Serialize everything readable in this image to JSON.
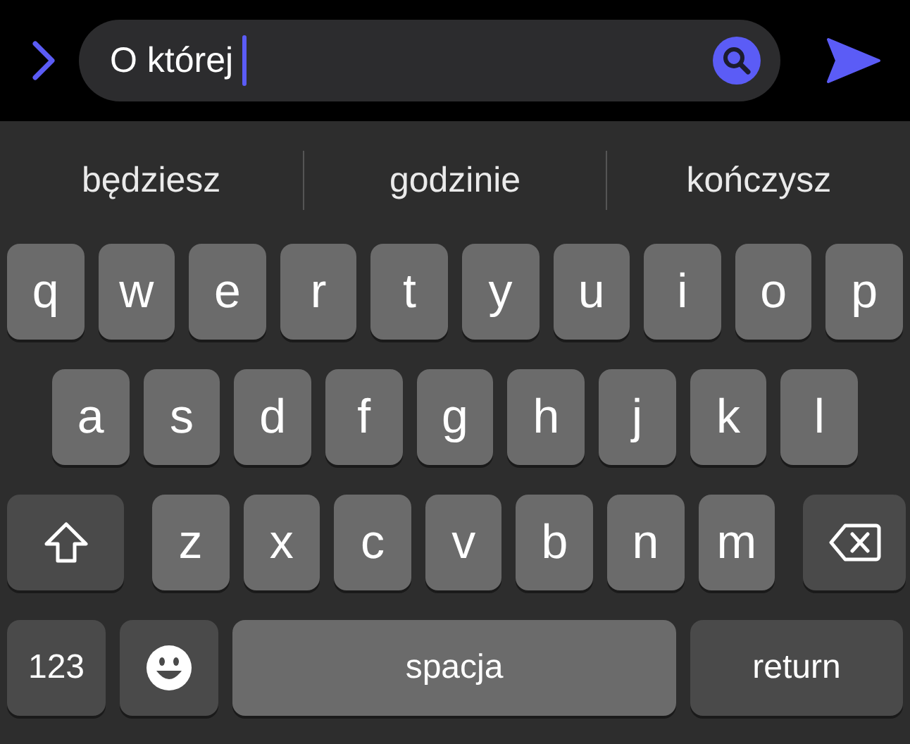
{
  "search_bar": {
    "value": "O której"
  },
  "suggestions": [
    "będziesz",
    "godzinie",
    "kończysz"
  ],
  "keyboard": {
    "rows": [
      {
        "keys": [
          {
            "kind": "letter",
            "label": "q"
          },
          {
            "kind": "letter",
            "label": "w"
          },
          {
            "kind": "letter",
            "label": "e"
          },
          {
            "kind": "letter",
            "label": "r"
          },
          {
            "kind": "letter",
            "label": "t"
          },
          {
            "kind": "letter",
            "label": "y"
          },
          {
            "kind": "letter",
            "label": "u"
          },
          {
            "kind": "letter",
            "label": "i"
          },
          {
            "kind": "letter",
            "label": "o"
          },
          {
            "kind": "letter",
            "label": "p"
          }
        ]
      },
      {
        "keys": [
          {
            "kind": "letter",
            "label": "a"
          },
          {
            "kind": "letter",
            "label": "s"
          },
          {
            "kind": "letter",
            "label": "d"
          },
          {
            "kind": "letter",
            "label": "f"
          },
          {
            "kind": "letter",
            "label": "g"
          },
          {
            "kind": "letter",
            "label": "h"
          },
          {
            "kind": "letter",
            "label": "j"
          },
          {
            "kind": "letter",
            "label": "k"
          },
          {
            "kind": "letter",
            "label": "l"
          }
        ]
      },
      {
        "keys": [
          {
            "kind": "shift"
          },
          {
            "kind": "letter",
            "label": "z"
          },
          {
            "kind": "letter",
            "label": "x"
          },
          {
            "kind": "letter",
            "label": "c"
          },
          {
            "kind": "letter",
            "label": "v"
          },
          {
            "kind": "letter",
            "label": "b"
          },
          {
            "kind": "letter",
            "label": "n"
          },
          {
            "kind": "letter",
            "label": "m"
          },
          {
            "kind": "backspace"
          }
        ]
      },
      {
        "keys": [
          {
            "kind": "numbers",
            "label": "123"
          },
          {
            "kind": "emoji"
          },
          {
            "kind": "space",
            "label": "spacja"
          },
          {
            "kind": "return",
            "label": "return"
          }
        ]
      }
    ]
  }
}
